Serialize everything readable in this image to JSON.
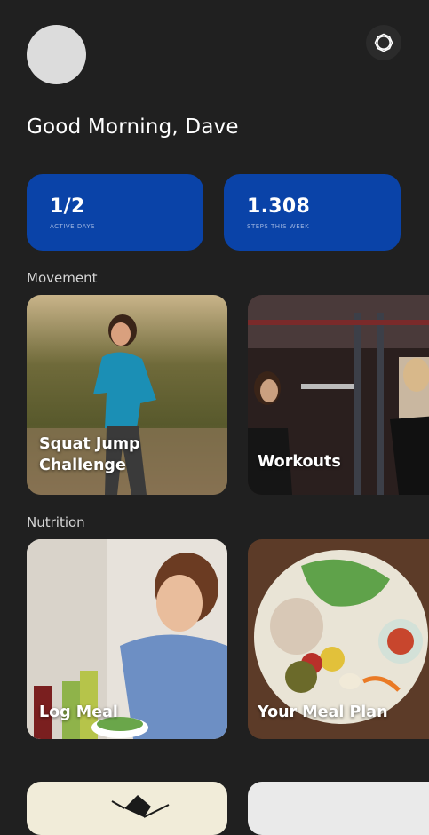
{
  "header": {
    "greeting": "Good Morning, Dave"
  },
  "stats": [
    {
      "value": "1/2",
      "label": "ACTIVE DAYS"
    },
    {
      "value": "1.308",
      "label": "STEPS THIS WEEK"
    }
  ],
  "sections": {
    "movement": {
      "title": "Movement",
      "cards": [
        {
          "label_line1": "Squat Jump",
          "label_line2": "Challenge"
        },
        {
          "label": "Workouts"
        }
      ]
    },
    "nutrition": {
      "title": "Nutrition",
      "cards": [
        {
          "label": "Log Meal"
        },
        {
          "label": "Your Meal Plan"
        }
      ]
    }
  },
  "icons": {
    "settings": "gear-icon"
  },
  "colors": {
    "background": "#202020",
    "stat_card": "#0a43a8",
    "avatar": "#dcdcdc"
  }
}
